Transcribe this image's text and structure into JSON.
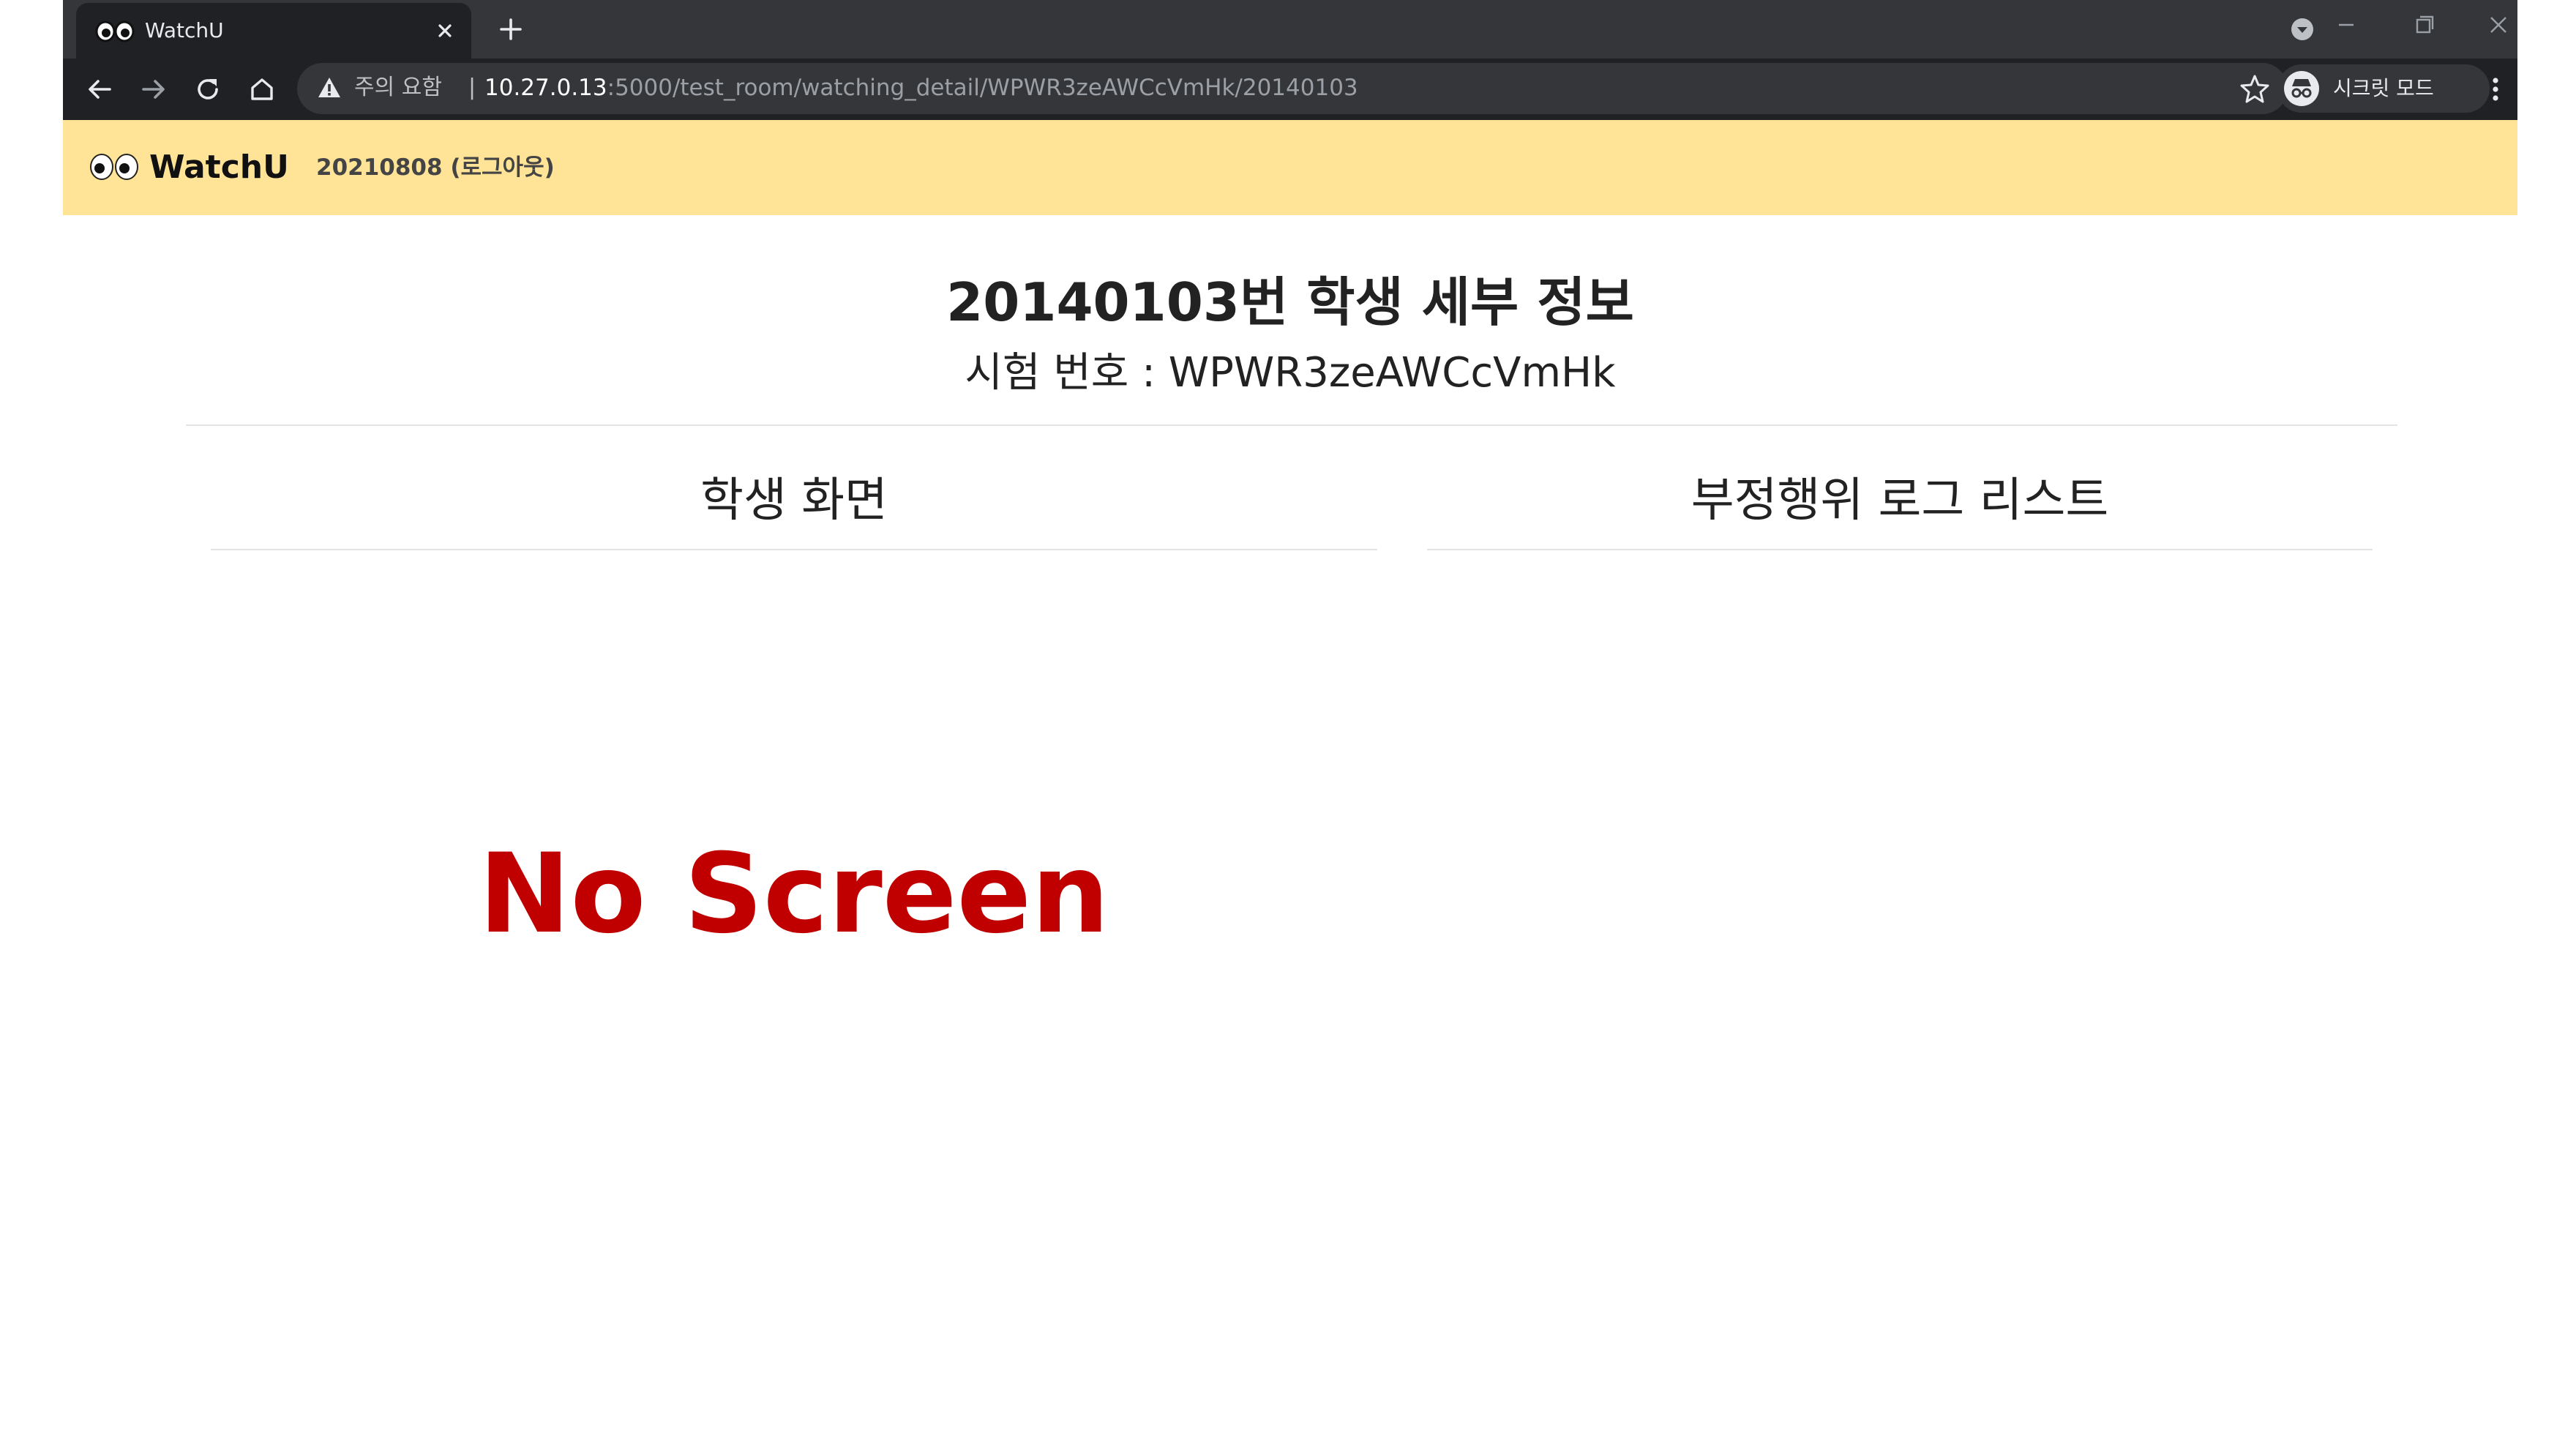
{
  "browser": {
    "tab": {
      "title": "WatchU"
    },
    "address": {
      "warning": "주의 요함",
      "separator": "|",
      "host": "10.27.0.13",
      "path": ":5000/test_room/watching_detail/WPWR3zeAWCcVmHk/20140103"
    },
    "profile": {
      "label": "시크릿 모드"
    },
    "icons": [
      "back-icon",
      "forward-icon",
      "reload-icon",
      "home-icon",
      "warning-icon",
      "star-icon",
      "incognito-icon",
      "menu-icon"
    ]
  },
  "navbar": {
    "brand": "WatchU",
    "user_logout": "20210808 (로그아웃)",
    "color": "#ffe497"
  },
  "main": {
    "title": "20140103번 학생 세부 정보",
    "exam_line": "시험 번호 : WPWR3zeAWCcVmHk",
    "left_heading": "학생 화면",
    "right_heading": "부정행위 로그 리스트",
    "no_screen": "No Screen",
    "no_screen_color": "#c00000"
  }
}
